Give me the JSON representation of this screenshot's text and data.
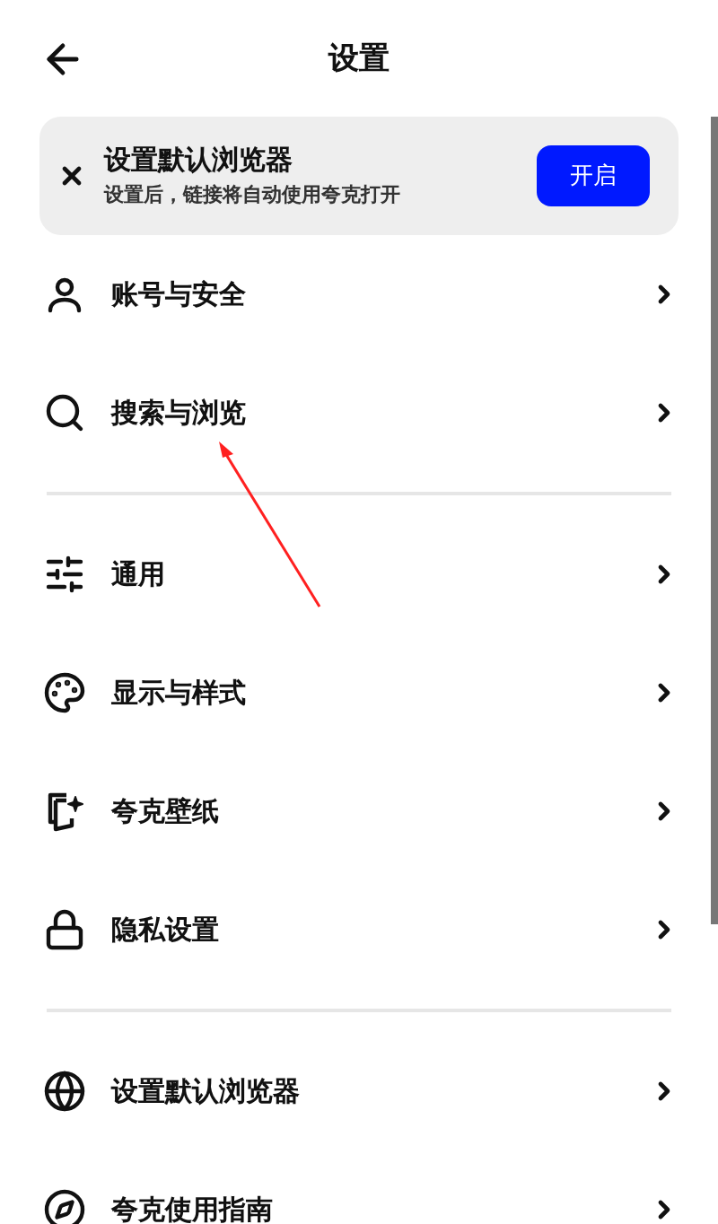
{
  "header": {
    "title": "设置"
  },
  "banner": {
    "title": "设置默认浏览器",
    "subtitle": "设置后，链接将自动使用夸克打开",
    "button": "开启"
  },
  "sections": [
    {
      "items": [
        {
          "label": "账号与安全"
        },
        {
          "label": "搜索与浏览"
        }
      ]
    },
    {
      "items": [
        {
          "label": "通用"
        },
        {
          "label": "显示与样式"
        },
        {
          "label": "夸克壁纸"
        },
        {
          "label": "隐私设置"
        }
      ]
    },
    {
      "items": [
        {
          "label": "设置默认浏览器"
        },
        {
          "label": "夸克使用指南"
        }
      ]
    }
  ]
}
